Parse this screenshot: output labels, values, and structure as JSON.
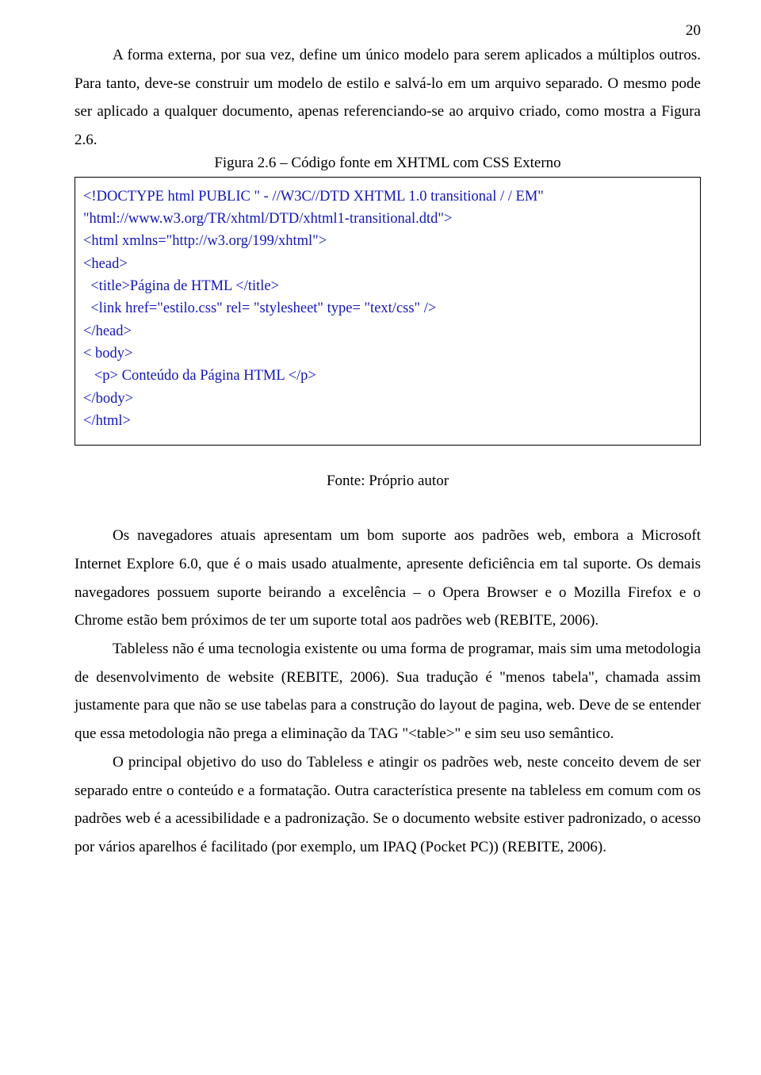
{
  "page_number": "20",
  "para1": "A forma externa, por sua vez, define um único modelo para serem aplicados a múltiplos outros. Para tanto, deve-se construir um modelo de estilo e salvá-lo em um arquivo separado. O mesmo pode ser aplicado a qualquer documento, apenas referenciando-se ao arquivo criado, como mostra a Figura 2.6.",
  "figure_caption": "Figura 2.6 – Código fonte em XHTML com CSS Externo",
  "code": {
    "l1": "<!DOCTYPE html PUBLIC \" - //W3C//DTD XHTML 1.0 transitional / / EM\"",
    "l2": "\"html://www.w3.org/TR/xhtml/DTD/xhtml1-transitional.dtd\">",
    "l3": "<html xmlns=\"http://w3.org/199/xhtml\">",
    "l4": "<head>",
    "l5": "  <title>Página de HTML </title>",
    "l6": "  <link href=\"estilo.css\" rel= \"stylesheet\" type= \"text/css\" />",
    "l7": "</head>",
    "l8": "< body>",
    "l9": "   <p> Conteúdo da Página HTML </p>",
    "l10": "</body>",
    "l11": "</html>"
  },
  "source_caption": "Fonte: Próprio autor",
  "para2": "Os navegadores atuais apresentam um bom suporte aos padrões web, embora a Microsoft Internet Explore 6.0, que é o mais usado atualmente, apresente deficiência em tal suporte. Os demais navegadores possuem suporte beirando a excelência – o Opera Browser e o Mozilla Firefox e o Chrome estão bem próximos de ter um suporte total aos padrões web (REBITE, 2006).",
  "para3": "Tableless não é uma tecnologia existente ou uma forma de programar, mais sim uma metodologia de desenvolvimento de website (REBITE, 2006). Sua tradução é \"menos tabela\", chamada assim justamente para que não se use tabelas para a construção do layout de pagina, web. Deve de se entender que essa metodologia não prega a eliminação da TAG \"<table>\" e sim seu uso semântico.",
  "para4": "O principal objetivo do uso do Tableless e atingir os padrões web, neste conceito devem de ser separado entre o conteúdo e a formatação. Outra característica presente na tableless em comum com os padrões web é a acessibilidade e a padronização. Se o documento website estiver padronizado, o acesso por vários aparelhos é facilitado (por exemplo, um IPAQ (Pocket PC)) (REBITE, 2006)."
}
